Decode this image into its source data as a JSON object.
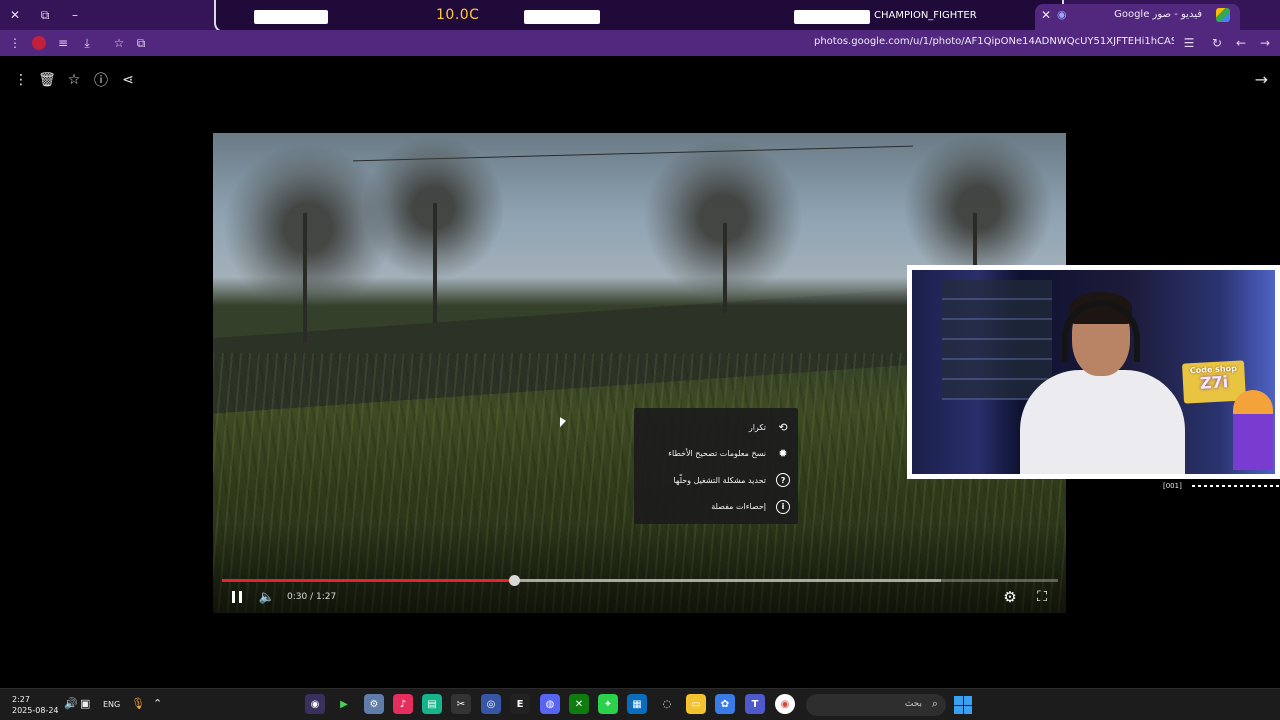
{
  "browser": {
    "active_tab_title": "فيديو - صور Google",
    "url": "photos.google.com/u/1/photo/AF1QipONe14ADNWQcUY51XJFTEHi1hCASuHnMY-Clij6",
    "window_controls": [
      "close-icon",
      "restore-icon",
      "minimize-icon"
    ]
  },
  "overlay_hud": {
    "score": "10.0C",
    "player_name": "CHAMPION_FIGHTER"
  },
  "viewer": {
    "toolbar_icons": [
      "more-icon",
      "trash-icon",
      "star-icon",
      "info-icon",
      "share-icon"
    ],
    "next_icon": "arrow-right-icon"
  },
  "player": {
    "time": "0:30 / 1:27",
    "played_fraction": 0.349,
    "buffered_fraction": 0.86
  },
  "context_menu": {
    "items": [
      {
        "label": "تكرار",
        "icon": "loop-icon"
      },
      {
        "label": "نسخ معلومات تصحيح الأخطاء",
        "icon": "bug-icon"
      },
      {
        "label": "تحديد مشكلة التشغيل وحلّها",
        "icon": "help-icon"
      },
      {
        "label": "إحصاءات مفصلة",
        "icon": "info-icon"
      }
    ]
  },
  "webcam": {
    "sign_line1": "Code shop",
    "sign_line2": "Z7i",
    "tag": "[001]"
  },
  "taskbar": {
    "time": "2:27",
    "date": "2025-08-24",
    "language": "ENG",
    "search_placeholder": "بحث"
  }
}
